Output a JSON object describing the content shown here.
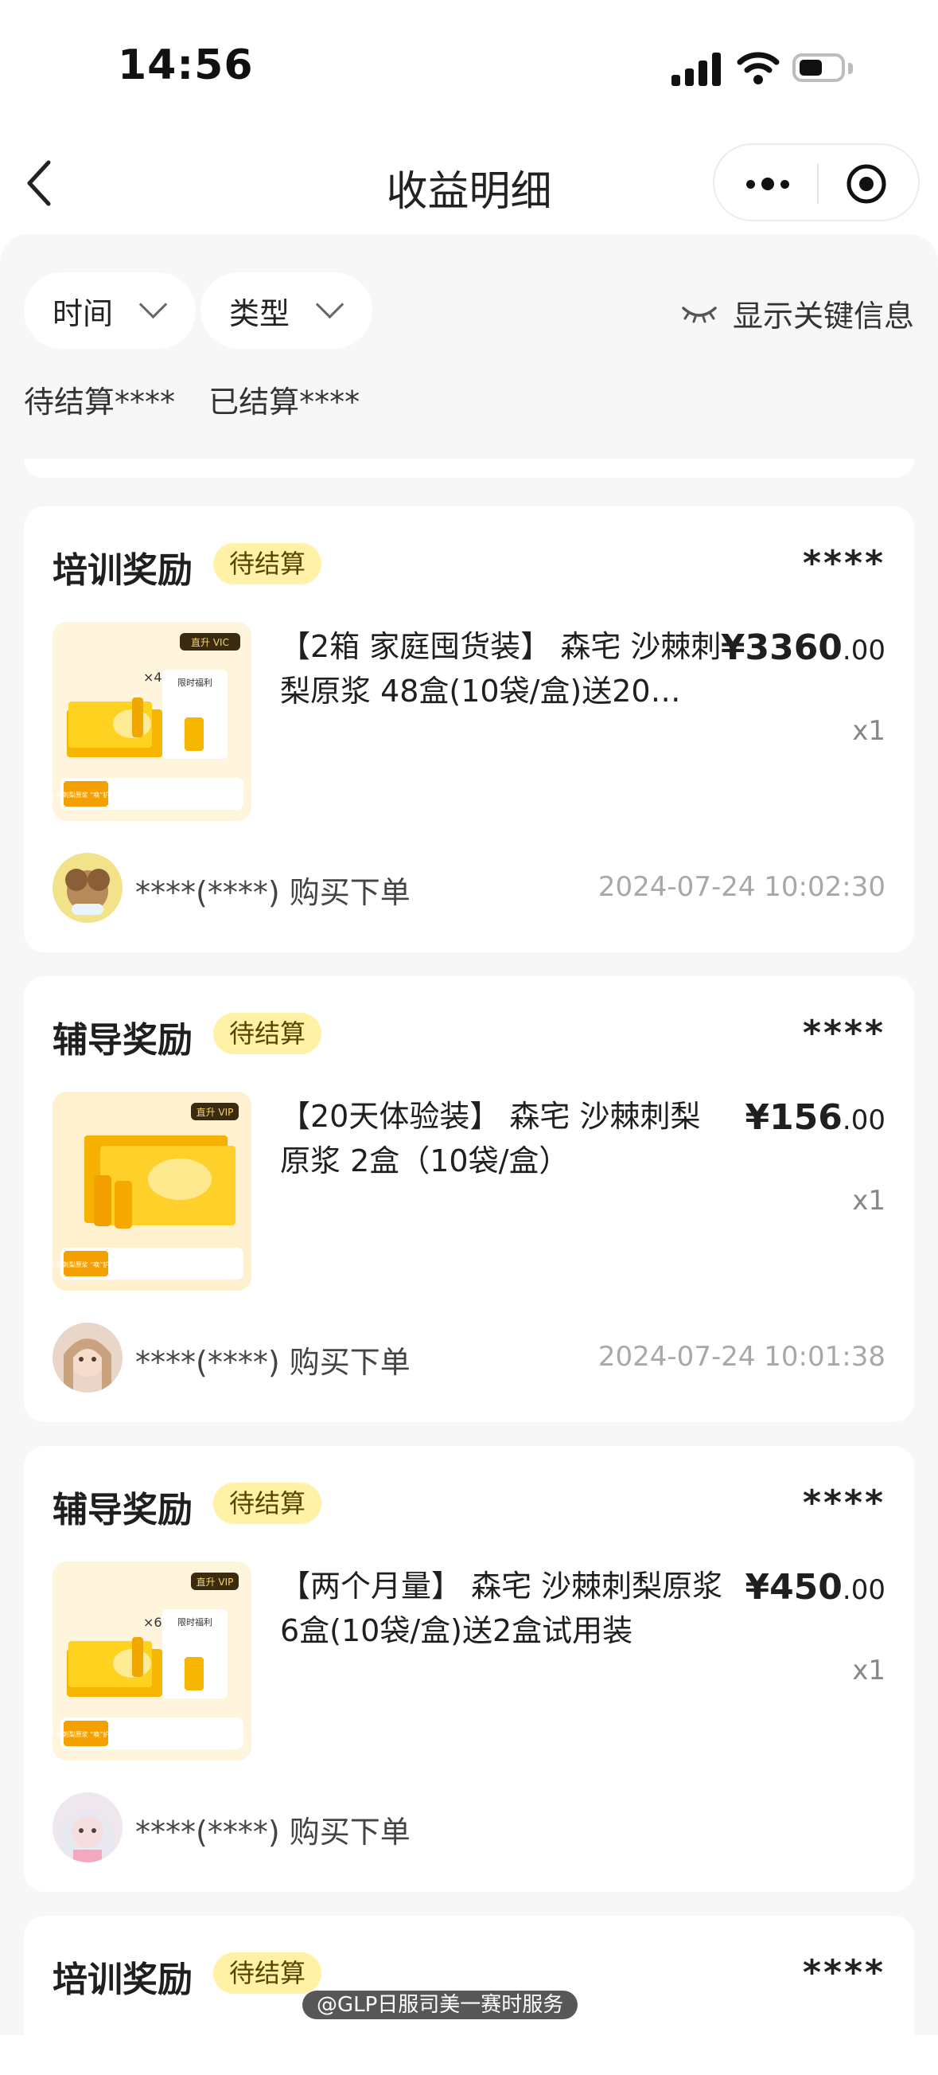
{
  "status_bar": {
    "time": "14:56"
  },
  "nav": {
    "title": "收益明细"
  },
  "filters": {
    "time_label": "时间",
    "type_label": "类型",
    "key_info_label": "显示关键信息"
  },
  "summary": {
    "pending": "待结算****",
    "settled": "已结算****"
  },
  "cards": [
    {
      "title": "培训奖励",
      "badge": "待结算",
      "amount": "****",
      "product": "【2箱 家庭囤货装】 森宅 沙棘刺梨原浆 48盒(10袋/盒)送20…",
      "price_main": "¥3360",
      "price_cents": ".00",
      "qty": "x1",
      "buyer": "****(****) 购买下单",
      "time": "2024-07-24 10:02:30",
      "thumb": {
        "corner": "直升 VIC",
        "count": "×48",
        "promo": "限时福利",
        "caption": "沙棘刺梨原浆 “唤”护健康"
      }
    },
    {
      "title": "辅导奖励",
      "badge": "待结算",
      "amount": "****",
      "product": "【20天体验装】 森宅 沙棘刺梨原浆 2盒（10袋/盒）",
      "price_main": "¥156",
      "price_cents": ".00",
      "qty": "x1",
      "buyer": "****(****) 购买下单",
      "time": "2024-07-24 10:01:38",
      "thumb": {
        "corner": "直升 VIP",
        "count": "",
        "promo": "",
        "caption": "沙棘刺梨原浆 “唤”护健康"
      }
    },
    {
      "title": "辅导奖励",
      "badge": "待结算",
      "amount": "****",
      "product": "【两个月量】 森宅 沙棘刺梨原浆 6盒(10袋/盒)送2盒试用装",
      "price_main": "¥450",
      "price_cents": ".00",
      "qty": "x1",
      "buyer": "****(****) 购买下单",
      "time": "",
      "thumb": {
        "corner": "直升 VIP",
        "count": "×6",
        "promo": "限时福利",
        "caption": "沙棘刺梨原浆 “唤”护健康"
      }
    },
    {
      "title": "培训奖励",
      "badge": "待结算",
      "amount": "****"
    }
  ],
  "watermark": "@GLP日服司美一赛时服务"
}
